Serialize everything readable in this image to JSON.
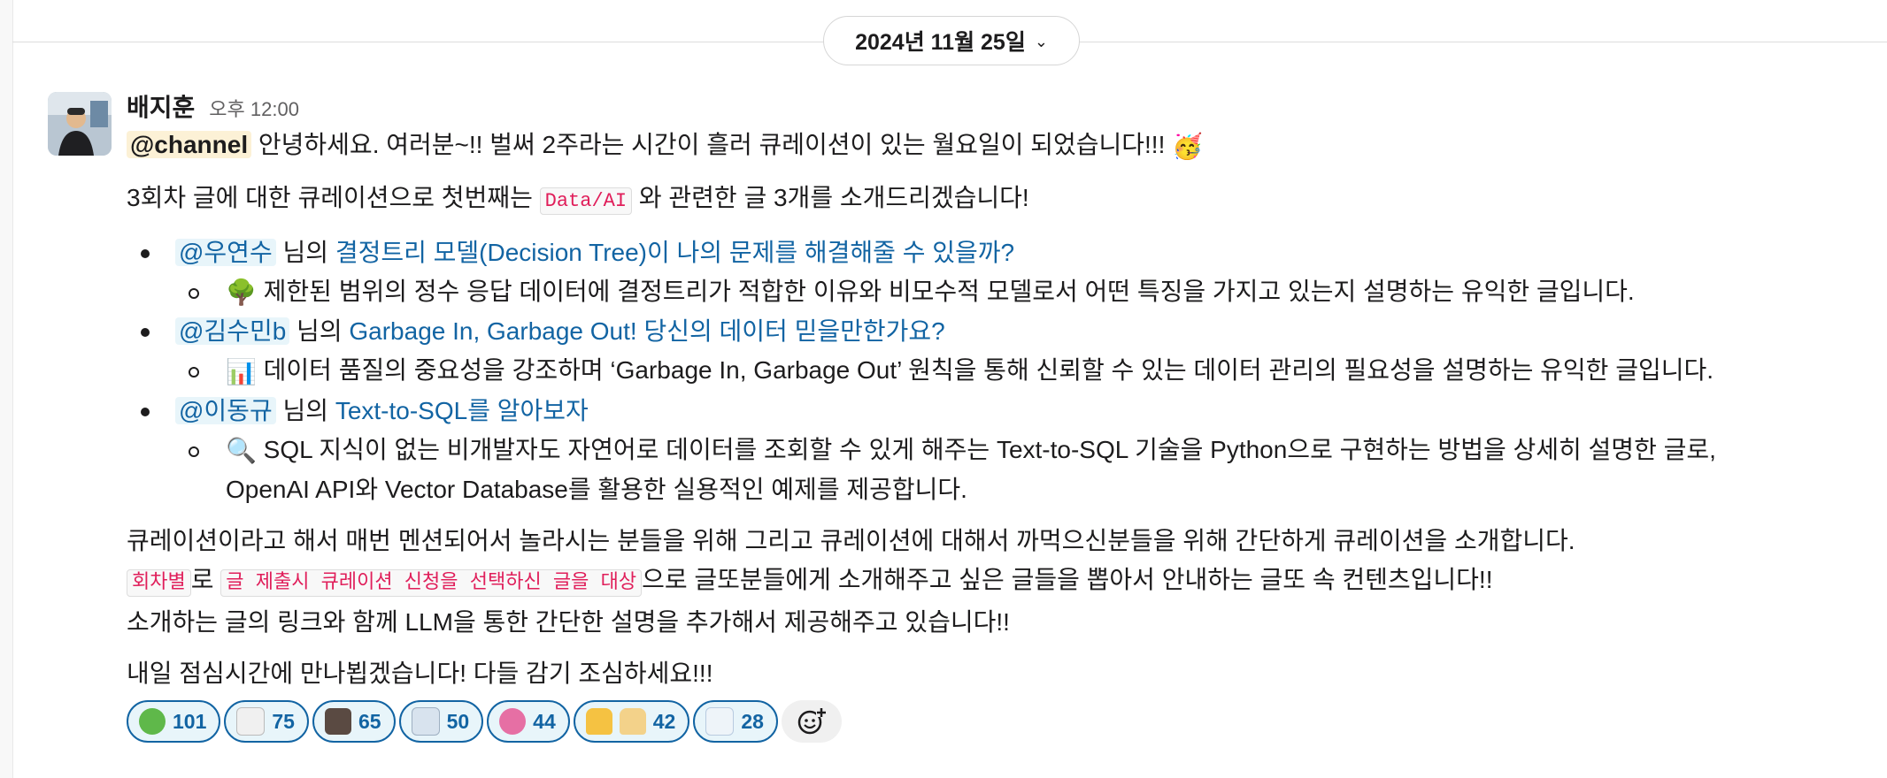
{
  "date_divider": {
    "label": "2024년 11월 25일",
    "chevron": "⌄"
  },
  "message": {
    "sender": "배지훈",
    "time": "오후 12:00",
    "line1": {
      "mention": "@channel",
      "text": " 안녕하세요. 여러분~!! 벌써 2주라는 시간이 흘러 큐레이션이 있는 월요일이 되었습니다!!! ",
      "emoji": "🥳"
    },
    "line2": {
      "before": "3회차 글에 대한 큐레이션으로 첫번째는 ",
      "code": "Data/AI",
      "after": " 와 관련한 글 3개를 소개드리겠습니다!"
    },
    "items": [
      {
        "mention": "@우연수",
        "mid": " 님의 ",
        "link": "결정트리 모델(Decision Tree)이 나의 문제를 해결해줄 수 있을까?",
        "emoji": "🌳",
        "desc": " 제한된 범위의 정수 응답 데이터에 결정트리가 적합한 이유와 비모수적 모델로서 어떤 특징을 가지고 있는지 설명하는 유익한 글입니다."
      },
      {
        "mention": "@김수민b",
        "mid": " 님의 ",
        "link": "Garbage In, Garbage Out! 당신의 데이터 믿을만한가요?",
        "emoji": "📊",
        "desc": " 데이터 품질의 중요성을 강조하며 ‘Garbage In, Garbage Out’ 원칙을 통해 신뢰할 수 있는 데이터 관리의 필요성을 설명하는 유익한 글입니다."
      },
      {
        "mention": "@이동규",
        "mid": " 님의 ",
        "link": "Text-to-SQL를 알아보자",
        "emoji": "🔍",
        "desc": " SQL 지식이 없는 비개발자도 자연어로 데이터를 조회할 수 있게 해주는 Text-to-SQL 기술을 Python으로 구현하는 방법을 상세히 설명한 글로,",
        "desc2": "OpenAI API와 Vector Database를 활용한 실용적인 예제를 제공합니다."
      }
    ],
    "para1": "큐레이션이라고 해서 매번 멘션되어서 놀라시는 분들을 위해 그리고 큐레이션에 대해서 까먹으신분들을 위해 간단하게 큐레이션을 소개합니다.",
    "para2": {
      "code1": "회차별",
      "t1": "로 ",
      "code2": "글 제출시 큐레이션 신청을 선택하신 글을 대상",
      "t2": "으로 글또분들에게 소개해주고 싶은 글들을 뽑아서 안내하는 글또 속 컨텐츠입니다!!"
    },
    "para3": "소개하는 글의 링크와 함께 LLM을 통한 간단한 설명을 추가해서 제공해주고 있습니다!!",
    "closing": "내일 점심시간에 만나뵙겠습니다! 다들 감기 조심하세요!!!"
  },
  "reactions": [
    {
      "icon": "frog-emoji",
      "count": "101",
      "color": "#5fb84a"
    },
    {
      "icon": "cat-emoji",
      "count": "75",
      "color": "#e9e9e9"
    },
    {
      "icon": "photo-emoji",
      "count": "65",
      "color": "#5a4a42"
    },
    {
      "icon": "cake-emoji",
      "count": "50",
      "color": "#d8e3ee"
    },
    {
      "icon": "pig-emoji",
      "count": "44",
      "color": "#e66fa4"
    },
    {
      "icon": "thumbs-up-emoji",
      "count": "42",
      "color": "#f5c242"
    },
    {
      "icon": "figure-emoji",
      "count": "28",
      "color": "#eef4f9"
    }
  ]
}
